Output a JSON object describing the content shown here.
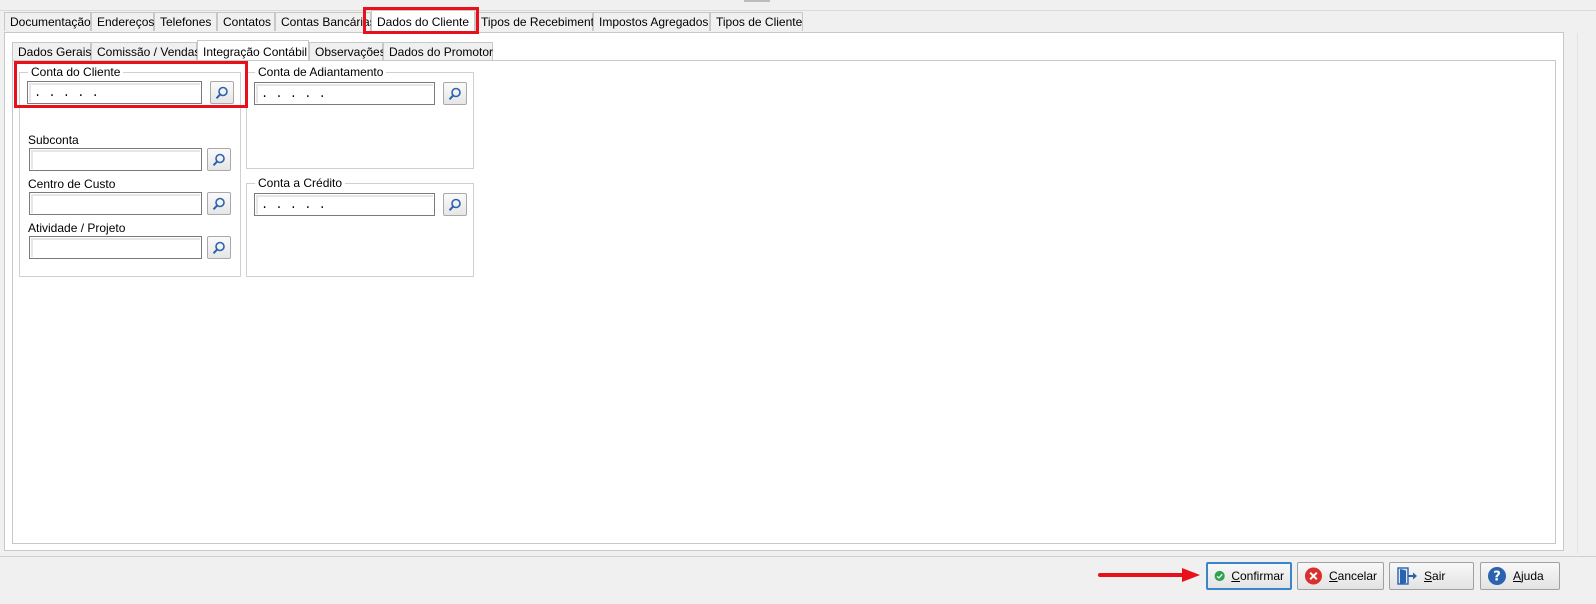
{
  "main_tabs": [
    {
      "label": "Documentação",
      "active": false
    },
    {
      "label": "Endereços",
      "active": false
    },
    {
      "label": "Telefones",
      "active": false
    },
    {
      "label": "Contatos",
      "active": false
    },
    {
      "label": "Contas Bancárias",
      "active": false
    },
    {
      "label": "Dados do Cliente",
      "active": true
    },
    {
      "label": "Tipos de Recebimento",
      "active": false
    },
    {
      "label": "Impostos Agregados",
      "active": false
    },
    {
      "label": "Tipos de Cliente",
      "active": false
    }
  ],
  "sub_tabs": [
    {
      "label": "Dados Gerais",
      "active": false
    },
    {
      "label": "Comissão / Vendas",
      "active": false
    },
    {
      "label": "Integração Contábil",
      "active": true
    },
    {
      "label": "Observações",
      "active": false
    },
    {
      "label": "Dados do Promotor",
      "active": false
    }
  ],
  "form": {
    "conta_cliente": {
      "title": "Conta do Cliente",
      "value": ". . . . ."
    },
    "subconta": {
      "label": "Subconta",
      "value": ""
    },
    "centro_custo": {
      "label": "Centro de Custo",
      "value": ""
    },
    "atividade_projeto": {
      "label": "Atividade / Projeto",
      "value": ""
    },
    "conta_adiantamento": {
      "title": "Conta de Adiantamento",
      "value": ". . . . ."
    },
    "conta_credito": {
      "title": "Conta a Crédito",
      "value": ". . . . ."
    }
  },
  "actions": {
    "confirmar": "Confirmar",
    "cancelar": "Cancelar",
    "sair": "Sair",
    "ajuda": "Ajuda"
  },
  "colors": {
    "highlight": "#e8101a",
    "confirm_icon": "#2ea44f",
    "cancel_icon": "#d9302c",
    "help_icon": "#2a62b0",
    "exit_icon": "#2a62b0"
  }
}
